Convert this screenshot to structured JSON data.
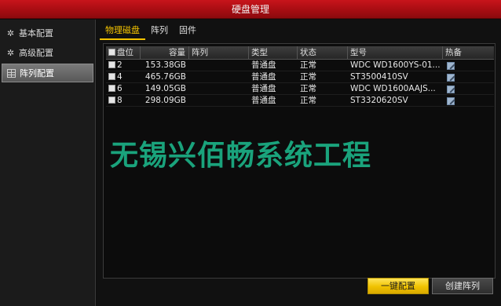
{
  "window": {
    "title": "硬盘管理"
  },
  "sidebar": {
    "items": [
      {
        "label": "基本配置",
        "icon": "gear-icon",
        "active": false
      },
      {
        "label": "高级配置",
        "icon": "gear-icon",
        "active": false
      },
      {
        "label": "阵列配置",
        "icon": "grid-icon",
        "active": true
      }
    ]
  },
  "tabs": [
    {
      "label": "物理磁盘",
      "active": true
    },
    {
      "label": "阵列",
      "active": false
    },
    {
      "label": "固件",
      "active": false
    }
  ],
  "table": {
    "headers": [
      "盘位",
      "容量",
      "阵列",
      "类型",
      "状态",
      "型号",
      "热备"
    ],
    "rows": [
      {
        "slot": "2",
        "capacity": "153.38GB",
        "array": "",
        "type": "普通盘",
        "status": "正常",
        "model": "WDC WD1600YS-01..."
      },
      {
        "slot": "4",
        "capacity": "465.76GB",
        "array": "",
        "type": "普通盘",
        "status": "正常",
        "model": "ST3500410SV"
      },
      {
        "slot": "6",
        "capacity": "149.05GB",
        "array": "",
        "type": "普通盘",
        "status": "正常",
        "model": "WDC WD1600AAJS..."
      },
      {
        "slot": "8",
        "capacity": "298.09GB",
        "array": "",
        "type": "普通盘",
        "status": "正常",
        "model": "ST3320620SV"
      }
    ]
  },
  "watermark": {
    "text": "无锡兴佰畅系统工程",
    "color": "#1aa37c"
  },
  "buttons": {
    "one_click": "一键配置",
    "create_array": "创建阵列"
  },
  "colors": {
    "titlebar": "#b01016",
    "accent": "#f5c400"
  }
}
